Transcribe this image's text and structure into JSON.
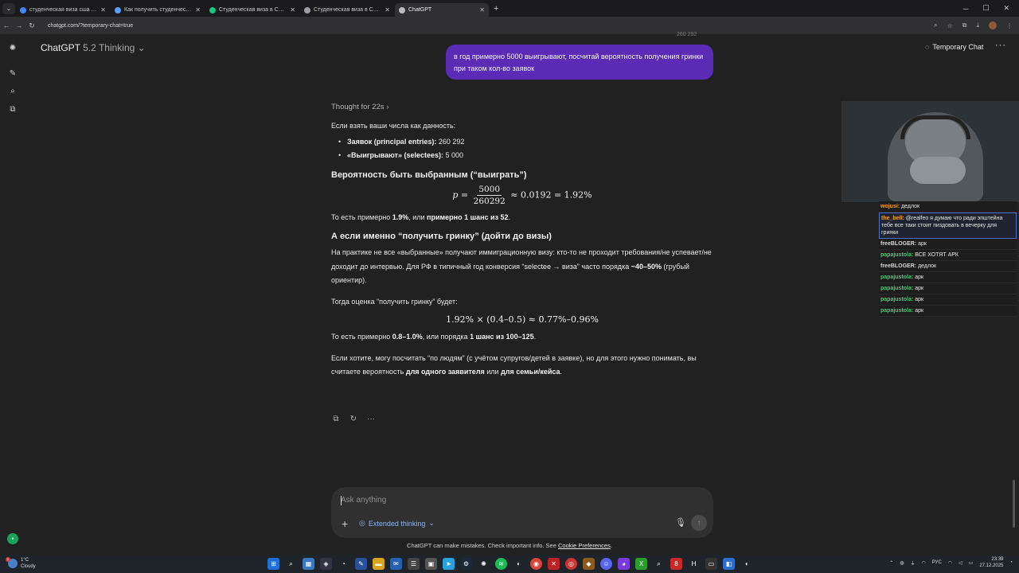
{
  "browser": {
    "tabs": [
      {
        "title": "студенческая виза сша учить",
        "color": "#4285f4"
      },
      {
        "title": "Как получить студенческую",
        "color": "#5aa0ff"
      },
      {
        "title": "Студенческая виза в США -",
        "color": "#19c37d"
      },
      {
        "title": "Студенческая виза в США с",
        "color": "#9aa0a6"
      },
      {
        "title": "ChatGPT",
        "color": "#bbbbbb"
      }
    ],
    "active_tab": 4,
    "new_tab": "+",
    "url": "chatgpt.com/?temporary-chat=true"
  },
  "header": {
    "model_name": "ChatGPT",
    "model_version": "5.2 Thinking",
    "temp_chat_label": "Temporary Chat"
  },
  "user_message": "в год примерно 5000 выигрывают, посчитай вероятность получения гринки при таком кол-во заявок",
  "cut_text": "260 292",
  "answer": {
    "thought": "Thought for 22s",
    "intro": "Если взять ваши числа как данность:",
    "bullets": [
      {
        "label": "Заявок (principal entries):",
        "value": "260 292"
      },
      {
        "label": "«Выигрывают» (selectees):",
        "value": "5 000"
      }
    ],
    "h1": "Вероятность быть выбранным (“выиграть”)",
    "formula1": {
      "var": "p =",
      "num": "5000",
      "den": "260292",
      "rest": "≈ 0.0192 = 1.92%"
    },
    "p1": {
      "a": "То есть примерно ",
      "b1": "1.9%",
      "c": ", или ",
      "b2": "примерно 1 шанс из 52",
      "d": "."
    },
    "h2": "А если именно “получить гринку” (дойти до визы)",
    "p2": {
      "a": "На практике не все «выбранные» получают иммиграционную визу: кто-то не проходит требования/не успевает/не доходит до интервью. Для РФ в типичный год конверсия “selectee → виза” часто порядка ",
      "b": "~40–50%",
      "c": " (грубый ориентир)."
    },
    "p3": "Тогда оценка “получить гринку” будет:",
    "formula2": "1.92% × (0.4–0.5) ≈ 0.77%–0.96%",
    "p4": {
      "a": "То есть примерно ",
      "b1": "0.8–1.0%",
      "c": ", или порядка ",
      "b2": "1 шанс из 100–125",
      "d": "."
    },
    "p5": {
      "a": "Если хотите, могу посчитать “по людям” (с учётом супругов/детей в заявке), но для этого нужно понимать, вы считаете вероятность ",
      "b1": "для одного заявителя",
      "c": " или ",
      "b2": "для семьи/кейса",
      "d": "."
    }
  },
  "composer": {
    "placeholder": "Ask anything",
    "mode": "Extended thinking"
  },
  "disclaimer": {
    "text": "ChatGPT can make mistakes. Check important info. See ",
    "link": "Cookie Preferences",
    "end": "."
  },
  "stream_chat": [
    {
      "nick": "wojusi",
      "color": "#f0a020",
      "text": "дедлок",
      "highlight": false
    },
    {
      "nick": "the_bell",
      "color": "#f0a020",
      "text": "@realfeo я думаю что ради эпштейна тебе все таки стоит пиздовать в вечерку для гринки",
      "highlight": true
    },
    {
      "nick": "freeBLOGER",
      "color": "#d8d8d8",
      "text": "арк",
      "highlight": false
    },
    {
      "nick": "papajustola",
      "color": "#3ecf6e",
      "text": "ВСЕ ХОТЯТ АРК",
      "highlight": false
    },
    {
      "nick": "freeBLOGER",
      "color": "#d8d8d8",
      "text": "дедлок",
      "highlight": false
    },
    {
      "nick": "papajustola",
      "color": "#3ecf6e",
      "text": "арк",
      "highlight": false
    },
    {
      "nick": "papajustola",
      "color": "#3ecf6e",
      "text": "арк",
      "highlight": false
    },
    {
      "nick": "papajustola",
      "color": "#3ecf6e",
      "text": "арк",
      "highlight": false
    },
    {
      "nick": "papajustola",
      "color": "#3ecf6e",
      "text": "арк",
      "highlight": false
    }
  ],
  "taskbar": {
    "weather_temp": "1°C",
    "weather_desc": "Cloudy",
    "lang": "РУС",
    "time": "23:39",
    "date": "27.12.2025"
  },
  "colors": {
    "user_bubble": "#5b2bb5",
    "accent_link": "#8ab4f8"
  }
}
